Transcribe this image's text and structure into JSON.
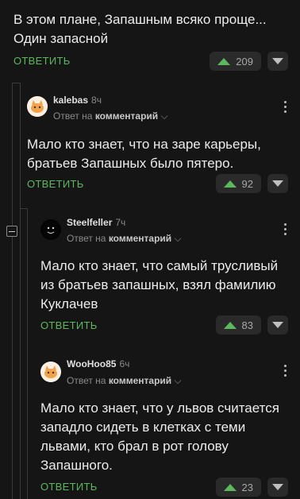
{
  "c0": {
    "text_lines": [
      "В этом плане, Запашным всяко проще...",
      "Один запасной"
    ],
    "reply": "ОТВЕТИТЬ",
    "votes": "209"
  },
  "c1": {
    "author": "kalebas",
    "time": "8ч",
    "meta_prefix": "Ответ на",
    "meta_link": "комментарий",
    "text_lines": [
      "Мало кто знает, что на заре карьеры,",
      "братьев Запашных было пятеро."
    ],
    "reply": "ОТВЕТИТЬ",
    "votes": "92"
  },
  "c2": {
    "author": "Steelfeller",
    "time": "7ч",
    "meta_prefix": "Ответ на",
    "meta_link": "комментарий",
    "text_lines": [
      "Мало кто знает, что самый трусливый",
      "из братьев запашных, взял фамилию",
      "Куклачев"
    ],
    "reply": "ОТВЕТИТЬ",
    "votes": "83"
  },
  "c3": {
    "author": "WooHoo85",
    "time": "6ч",
    "meta_prefix": "Ответ на",
    "meta_link": "комментарий",
    "text_lines": [
      "Мало кто знает, что у львов считается",
      "западло сидеть в клетках с теми",
      "львами, кто брал в рот голову",
      "Запашного."
    ],
    "reply": "ОТВЕТИТЬ",
    "votes": "23"
  },
  "colors": {
    "accent": "#5cb85c",
    "bg": "#151515",
    "pill": "#2a2a2a"
  },
  "icons": {
    "upvote": "triangle-up-icon",
    "downvote": "triangle-down-icon",
    "more": "vertical-dots-icon",
    "collapse": "minus-box-icon",
    "chevron": "chevron-down-icon"
  }
}
